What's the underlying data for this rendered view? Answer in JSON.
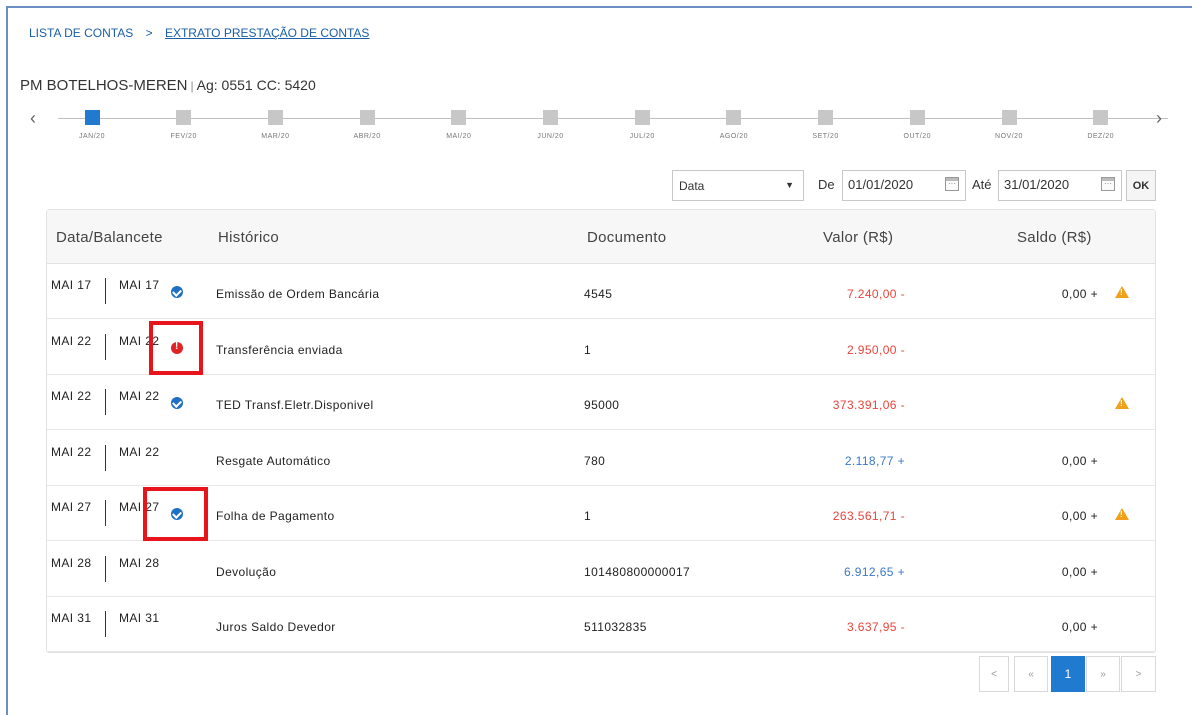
{
  "breadcrumb": {
    "parent": "LISTA DE CONTAS",
    "separator": ">",
    "current": "EXTRATO PRESTAÇÃO DE CONTAS"
  },
  "account": {
    "name": "PM BOTELHOS-MEREN",
    "divider": "|",
    "details": "Ag: 0551 CC: 5420"
  },
  "timeline": {
    "prev": "‹",
    "next": "›",
    "months": [
      "JAN/20",
      "FEV/20",
      "MAR/20",
      "ABR/20",
      "MAI/20",
      "JUN/20",
      "JUL/20",
      "AGO/20",
      "SET/20",
      "OUT/20",
      "NOV/20",
      "DEZ/20"
    ],
    "active_index": 0
  },
  "filter": {
    "type_value": "Data",
    "label_from": "De",
    "from": "01/01/2020",
    "label_to": "Até",
    "to": "31/01/2020",
    "ok": "OK"
  },
  "table": {
    "headers": {
      "date": "Data/Balancete",
      "history": "Histórico",
      "document": "Documento",
      "value": "Valor (R$)",
      "balance": "Saldo (R$)"
    },
    "rows": [
      {
        "date": "MAI 17",
        "balancete": "MAI 17",
        "status": "ok",
        "history": "Emissão de Ordem Bancária",
        "document": "4545",
        "value": "7.240,00 -",
        "sign": "neg",
        "balance": "0,00 +",
        "warning": true
      },
      {
        "date": "MAI 22",
        "balancete": "MAI 22",
        "status": "error",
        "history": "Transferência enviada",
        "document": "1",
        "value": "2.950,00 -",
        "sign": "neg",
        "balance": "",
        "warning": false
      },
      {
        "date": "MAI 22",
        "balancete": "MAI 22",
        "status": "ok",
        "history": "TED Transf.Eletr.Disponivel",
        "document": "95000",
        "value": "373.391,06 -",
        "sign": "neg",
        "balance": "",
        "warning": true
      },
      {
        "date": "MAI 22",
        "balancete": "MAI 22",
        "status": "",
        "history": "Resgate Automático",
        "document": "780",
        "value": "2.118,77 +",
        "sign": "pos",
        "balance": "0,00 +",
        "warning": false
      },
      {
        "date": "MAI 27",
        "balancete": "MAI 27",
        "status": "ok",
        "history": "Folha de Pagamento",
        "document": "1",
        "value": "263.561,71 -",
        "sign": "neg",
        "balance": "0,00 +",
        "warning": true
      },
      {
        "date": "MAI 28",
        "balancete": "MAI 28",
        "status": "",
        "history": "Devolução",
        "document": "101480800000017",
        "value": "6.912,65 +",
        "sign": "pos",
        "balance": "0,00 +",
        "warning": false
      },
      {
        "date": "MAI 31",
        "balancete": "MAI 31",
        "status": "",
        "history": "Juros Saldo Devedor",
        "document": "511032835",
        "value": "3.637,95 -",
        "sign": "neg",
        "balance": "0,00 +",
        "warning": false
      }
    ]
  },
  "pagination": {
    "first": "<",
    "prev": "«",
    "current": "1",
    "next": "»",
    "last": ">"
  },
  "colors": {
    "accent": "#1f7ad0",
    "negative": "#e8443a",
    "positive": "#3a78c9",
    "warning": "#f0a01a",
    "error": "#e02424",
    "highlight": "#e8141b"
  }
}
